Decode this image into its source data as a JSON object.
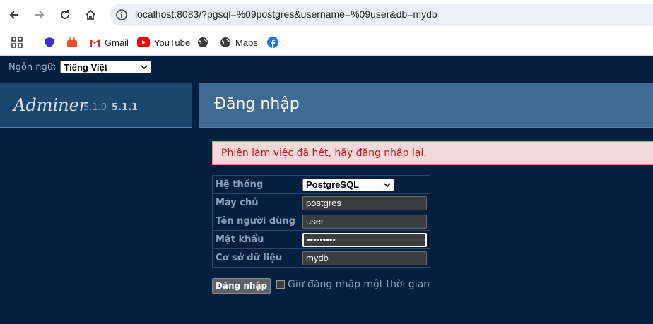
{
  "browser": {
    "url": "localhost:8083/?pgsql=%09postgres&username=%09user&db=mydb",
    "bookmarks": [
      {
        "label": "Gmail"
      },
      {
        "label": "YouTube"
      },
      {
        "label": "Maps"
      }
    ]
  },
  "language": {
    "label": "Ngôn ngữ:",
    "selected": "Tiếng Việt"
  },
  "app": {
    "name": "Adminer",
    "version_current": "5.1.0",
    "version_new": "5.1.1"
  },
  "page": {
    "title": "Đăng nhập",
    "error": "Phiên làm việc đã hết, hãy đăng nhập lại."
  },
  "form": {
    "system_label": "Hệ thống",
    "system_value": "PostgreSQL",
    "server_label": "Máy chủ",
    "server_value": "postgres",
    "username_label": "Tên người dùng",
    "username_value": "user",
    "password_label": "Mật khẩu",
    "password_value": "•••••••••",
    "database_label": "Cơ sở dữ liệu",
    "database_value": "mydb",
    "submit_label": "Đăng nhập",
    "remember_label": "Giữ đăng nhập một thời gian"
  },
  "colors": {
    "background": "#05203f",
    "heading": "#3e6b94",
    "error_text": "#d0101a"
  }
}
